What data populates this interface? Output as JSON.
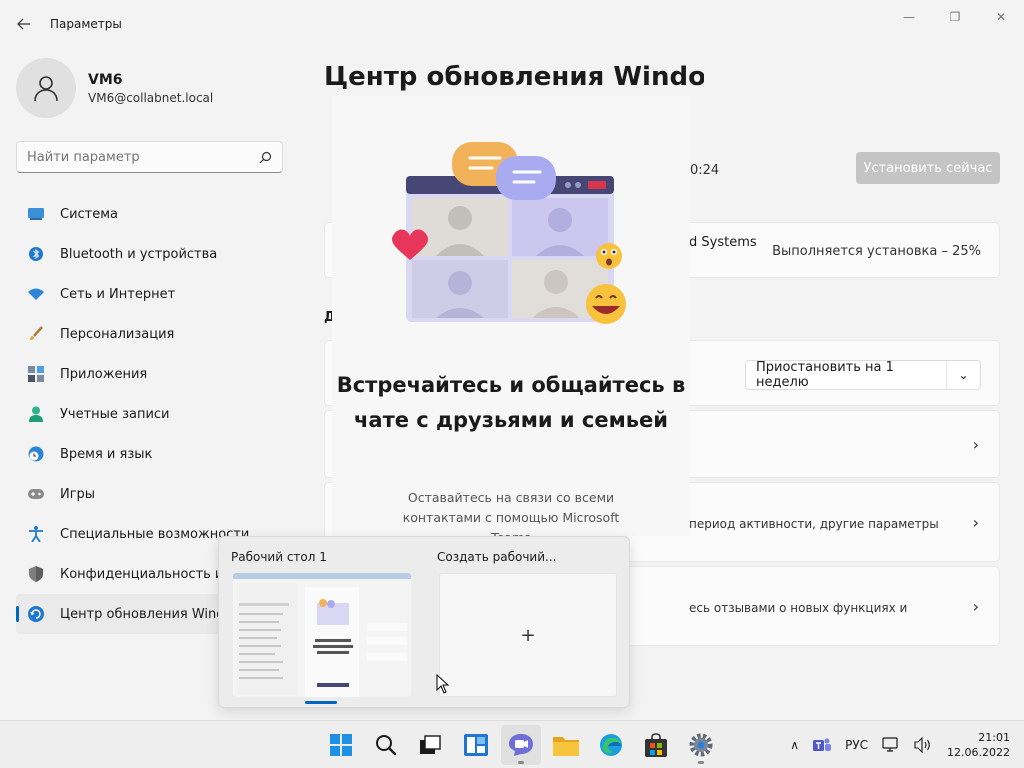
{
  "window": {
    "title": "Параметры",
    "controls": {
      "minimize": "—",
      "maximize": "❐",
      "close": "✕"
    }
  },
  "profile": {
    "name": "VM6",
    "email": "VM6@collabnet.local"
  },
  "search": {
    "placeholder": "Найти параметр"
  },
  "sidebar": {
    "items": [
      {
        "label": "Система",
        "icon": "system-icon"
      },
      {
        "label": "Bluetooth и устройства",
        "icon": "bluetooth-icon"
      },
      {
        "label": "Сеть и Интернет",
        "icon": "network-icon"
      },
      {
        "label": "Персонализация",
        "icon": "brush-icon"
      },
      {
        "label": "Приложения",
        "icon": "apps-icon"
      },
      {
        "label": "Учетные записи",
        "icon": "account-icon"
      },
      {
        "label": "Время и язык",
        "icon": "time-language-icon"
      },
      {
        "label": "Игры",
        "icon": "gamepad-icon"
      },
      {
        "label": "Специальные возможности",
        "icon": "accessibility-icon"
      },
      {
        "label": "Конфиденциальность и защита",
        "icon": "shield-icon"
      },
      {
        "label": "Центр обновления Windows",
        "icon": "windows-update-icon",
        "active": true
      }
    ]
  },
  "main": {
    "heading": "Центр обновления Windows",
    "last_check": "0:24",
    "install_button": "Установить сейчас",
    "update_card": {
      "name": "d Systems",
      "status": "Выполняется установка – 25%"
    },
    "section_label": "Д",
    "pause": {
      "label": "Приостановить на 1 неделю"
    },
    "active_hours": {
      "subtitle": "период активности, другие параметры"
    },
    "insider": {
      "subtitle": "есь отзывами о новых функциях и"
    }
  },
  "chat_flyout": {
    "heading": "Встречайтесь и общайтесь в чате с друзьями и семьей",
    "description": "Оставайтесь на связи со всеми контактами с помощью Microsoft Teams"
  },
  "desktops": {
    "items": [
      {
        "label": "Рабочий стол 1"
      },
      {
        "label": "Создать рабочий...",
        "glyph": "+"
      }
    ]
  },
  "taskbar": {
    "pinned": [
      "start-icon",
      "search-icon",
      "task-view-icon",
      "widgets-icon",
      "chat-icon",
      "file-explorer-icon",
      "edge-icon",
      "store-icon",
      "settings-icon"
    ],
    "tray": {
      "chevron": "∧",
      "language": "РУС",
      "time": "21:01",
      "date": "12.06.2022"
    }
  },
  "colors": {
    "accent": "#0067c0",
    "background": "#f3f3f3",
    "taskbar": "#eeeeee",
    "disabled_button": "#c4c4c4"
  }
}
